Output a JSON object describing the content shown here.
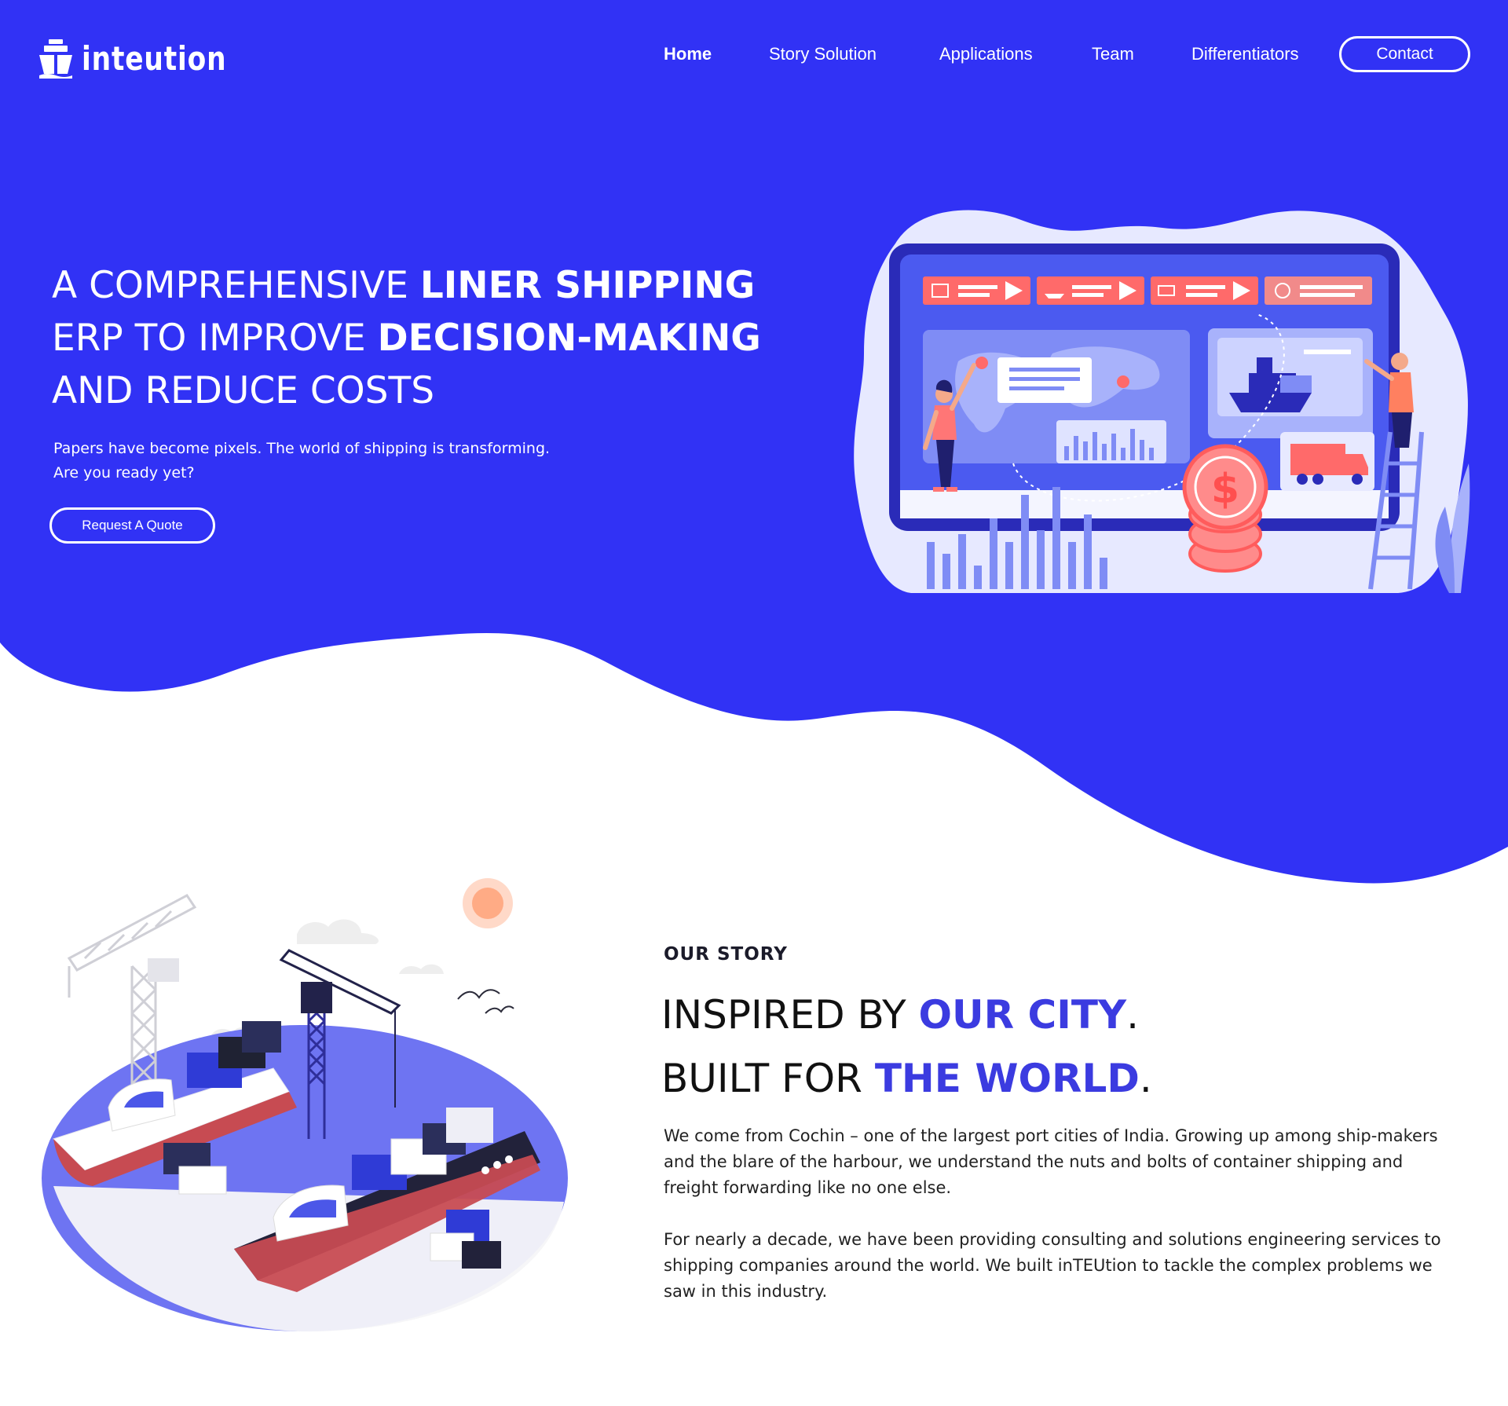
{
  "brand": {
    "name": "inTEUtion",
    "primary_color": "#3132f5",
    "accent_color": "#3b3be0",
    "logo_icon": "ship-icon"
  },
  "nav": {
    "items": [
      {
        "label": "Home",
        "active": true
      },
      {
        "label": "Story Solution",
        "active": false
      },
      {
        "label": "Applications",
        "active": false
      },
      {
        "label": "Team",
        "active": false
      },
      {
        "label": "Differentiators",
        "active": false
      }
    ],
    "contact_label": "Contact"
  },
  "hero": {
    "title_lines": [
      {
        "normal": "A COMPREHENSIVE ",
        "bold": "LINER SHIPPING"
      },
      {
        "normal": "ERP TO IMPROVE ",
        "bold": "DECISION-MAKING"
      },
      {
        "normal": "AND REDUCE COSTS",
        "bold": ""
      }
    ],
    "subtitle_lines": [
      "Papers have become pixels. The world of shipping is transforming.",
      "Are you ready yet?"
    ],
    "cta_label": "Request A Quote",
    "illustration": "erp-dashboard-illustration"
  },
  "story": {
    "label": "OUR STORY",
    "heading_line1": {
      "normal": "INSPIRED BY ",
      "accent": "OUR CITY",
      "end": "."
    },
    "heading_line2": {
      "normal": "BUILT FOR ",
      "accent": "THE WORLD",
      "end": "."
    },
    "paragraphs": [
      "We come from Cochin – one of the largest port cities of India. Growing up among ship-makers and the blare of the harbour, we understand the nuts and bolts of container shipping and freight forwarding like no one else.",
      "For nearly a decade, we have been providing consulting and solutions engineering services to shipping companies around the world. We built inTEUtion to tackle the complex problems we saw in this industry."
    ],
    "illustration": "port-cargo-ships-illustration"
  }
}
